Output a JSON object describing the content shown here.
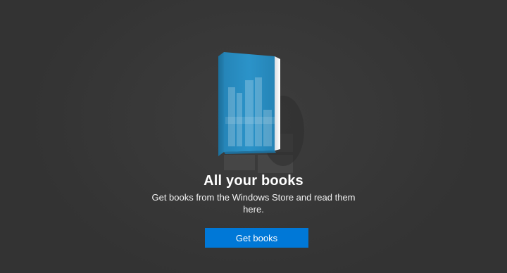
{
  "main": {
    "title": "All your books",
    "subtitle": "Get books from the Windows Store and read them here.",
    "primary_button_label": "Get books",
    "illustration_icon": "book-icon"
  },
  "colors": {
    "background": "#363636",
    "accent": "#0078d7",
    "book_cover": "#2a8fc4"
  }
}
